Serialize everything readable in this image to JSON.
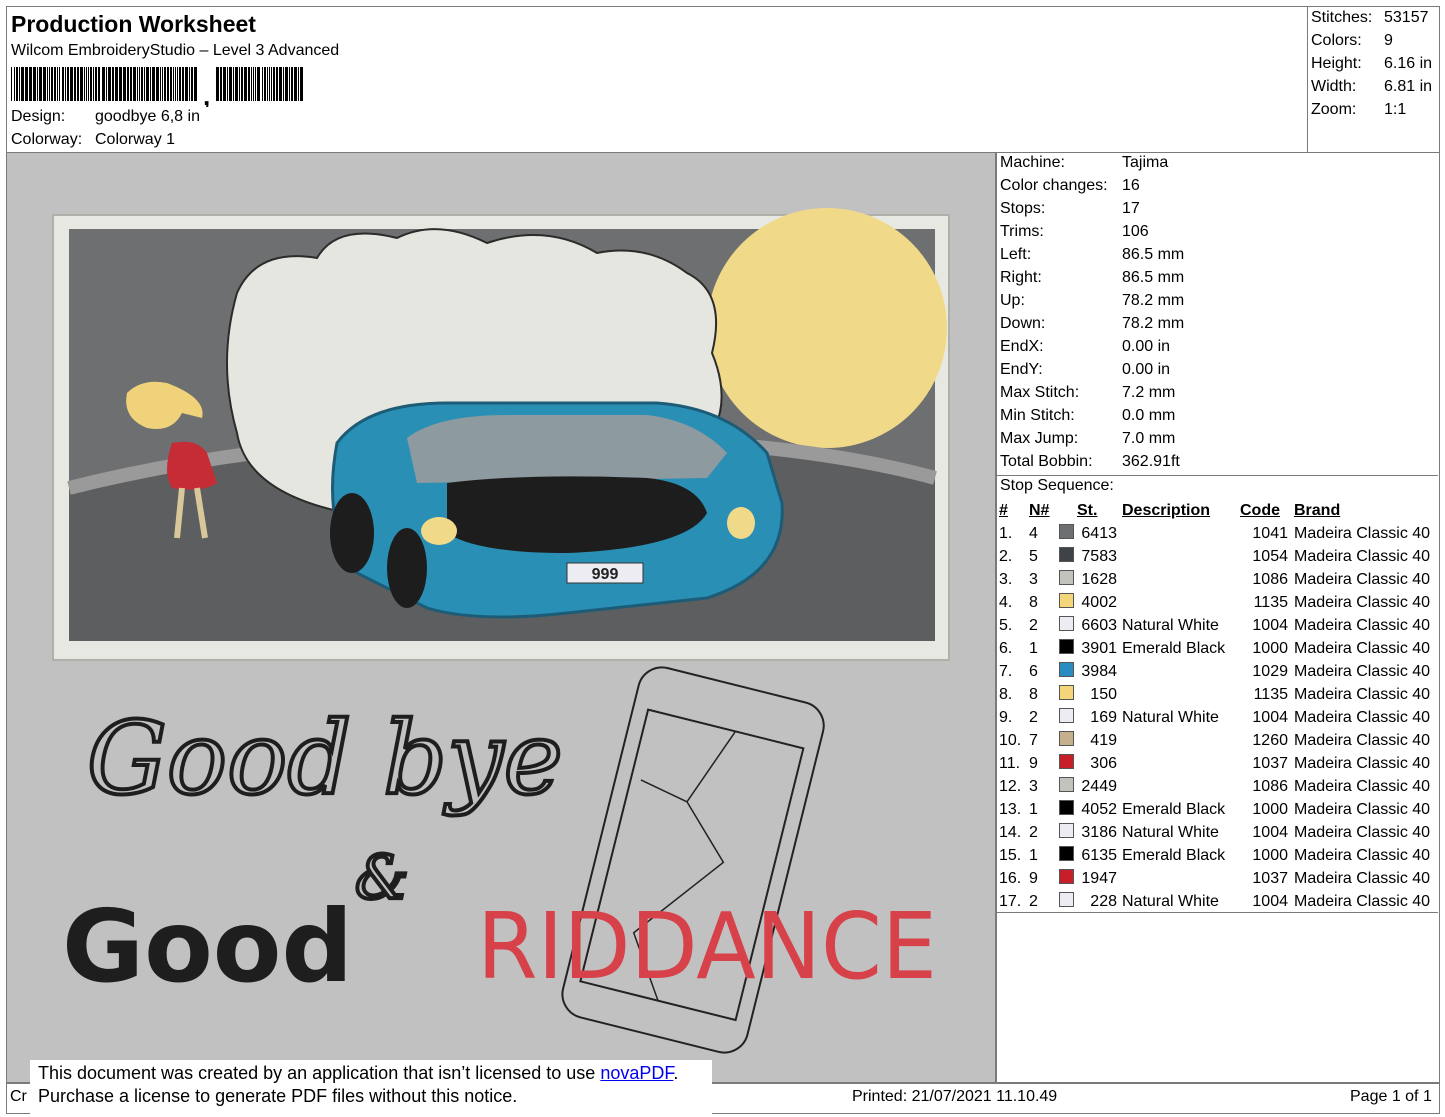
{
  "header": {
    "title": "Production Worksheet",
    "subtitle": "Wilcom EmbroideryStudio – Level 3 Advanced",
    "design_label": "Design:",
    "design_value": "goodbye 6,8 in",
    "colorway_label": "Colorway:",
    "colorway_value": "Colorway 1"
  },
  "stats": {
    "stitches_label": "Stitches:",
    "stitches": "53157",
    "colors_label": "Colors:",
    "colors": "9",
    "height_label": "Height:",
    "height": "6.16 in",
    "width_label": "Width:",
    "width": "6.81 in",
    "zoom_label": "Zoom:",
    "zoom": "1:1"
  },
  "preview": {
    "text_goodbye": "Good bye",
    "text_amp": "&",
    "text_good": "Good",
    "text_riddance": "RIDDANCE",
    "plate": "999",
    "colors": {
      "background": "#c1c1c1",
      "sky": "#6e6f70",
      "moon": "#f1d98a",
      "car": "#2a8fb5",
      "smoke": "#e6e6e0",
      "dress": "#c62c35",
      "hair": "#f0d27a",
      "riddance": "#d7424a",
      "goodbye": "#1e1e1e"
    }
  },
  "details": {
    "machine_label": "Machine:",
    "machine": "Tajima",
    "color_changes_label": "Color changes:",
    "color_changes": "16",
    "stops_label": "Stops:",
    "stops": "17",
    "trims_label": "Trims:",
    "trims": "106",
    "left_label": "Left:",
    "left": "86.5 mm",
    "right_label": "Right:",
    "right": "86.5 mm",
    "up_label": "Up:",
    "up": "78.2 mm",
    "down_label": "Down:",
    "down": "78.2 mm",
    "endx_label": "EndX:",
    "endx": "0.00 in",
    "endy_label": "EndY:",
    "endy": "0.00 in",
    "max_stitch_label": "Max Stitch:",
    "max_stitch": "7.2 mm",
    "min_stitch_label": "Min Stitch:",
    "min_stitch": "0.0 mm",
    "max_jump_label": "Max Jump:",
    "max_jump": "7.0 mm",
    "total_bobbin_label": "Total Bobbin:",
    "total_bobbin": "362.91ft",
    "stop_sequence_label": "Stop Sequence:"
  },
  "stop_table": {
    "headers": {
      "idx": "#",
      "n": "N#",
      "st": "St.",
      "desc": "Description",
      "code": "Code",
      "brand": "Brand"
    },
    "rows": [
      {
        "idx": "1.",
        "n": "4",
        "color": "#6d6f71",
        "st": "6413",
        "desc": "",
        "code": "1041",
        "brand": "Madeira Classic 40"
      },
      {
        "idx": "2.",
        "n": "5",
        "color": "#3f4247",
        "st": "7583",
        "desc": "",
        "code": "1054",
        "brand": "Madeira Classic 40"
      },
      {
        "idx": "3.",
        "n": "3",
        "color": "#c3c3bd",
        "st": "1628",
        "desc": "",
        "code": "1086",
        "brand": "Madeira Classic 40"
      },
      {
        "idx": "4.",
        "n": "8",
        "color": "#f5d57a",
        "st": "4002",
        "desc": "",
        "code": "1135",
        "brand": "Madeira Classic 40"
      },
      {
        "idx": "5.",
        "n": "2",
        "color": "#ececf2",
        "st": "6603",
        "desc": "Natural White",
        "code": "1004",
        "brand": "Madeira Classic 40"
      },
      {
        "idx": "6.",
        "n": "1",
        "color": "#000000",
        "st": "3901",
        "desc": "Emerald Black",
        "code": "1000",
        "brand": "Madeira Classic 40"
      },
      {
        "idx": "7.",
        "n": "6",
        "color": "#2a8cc0",
        "st": "3984",
        "desc": "",
        "code": "1029",
        "brand": "Madeira Classic 40"
      },
      {
        "idx": "8.",
        "n": "8",
        "color": "#f5d57a",
        "st": "150",
        "desc": "",
        "code": "1135",
        "brand": "Madeira Classic 40"
      },
      {
        "idx": "9.",
        "n": "2",
        "color": "#ececf2",
        "st": "169",
        "desc": "Natural White",
        "code": "1004",
        "brand": "Madeira Classic 40"
      },
      {
        "idx": "10.",
        "n": "7",
        "color": "#c4b08c",
        "st": "419",
        "desc": "",
        "code": "1260",
        "brand": "Madeira Classic 40"
      },
      {
        "idx": "11.",
        "n": "9",
        "color": "#c81e2a",
        "st": "306",
        "desc": "",
        "code": "1037",
        "brand": "Madeira Classic 40"
      },
      {
        "idx": "12.",
        "n": "3",
        "color": "#c3c3bd",
        "st": "2449",
        "desc": "",
        "code": "1086",
        "brand": "Madeira Classic 40"
      },
      {
        "idx": "13.",
        "n": "1",
        "color": "#000000",
        "st": "4052",
        "desc": "Emerald Black",
        "code": "1000",
        "brand": "Madeira Classic 40"
      },
      {
        "idx": "14.",
        "n": "2",
        "color": "#ececf2",
        "st": "3186",
        "desc": "Natural White",
        "code": "1004",
        "brand": "Madeira Classic 40"
      },
      {
        "idx": "15.",
        "n": "1",
        "color": "#000000",
        "st": "6135",
        "desc": "Emerald Black",
        "code": "1000",
        "brand": "Madeira Classic 40"
      },
      {
        "idx": "16.",
        "n": "9",
        "color": "#c81e2a",
        "st": "1947",
        "desc": "",
        "code": "1037",
        "brand": "Madeira Classic 40"
      },
      {
        "idx": "17.",
        "n": "2",
        "color": "#ececf2",
        "st": "228",
        "desc": "Natural White",
        "code": "1004",
        "brand": "Madeira Classic 40"
      }
    ]
  },
  "footer": {
    "cr": "Cr",
    "printed": "Printed: 21/07/2021 11.10.49",
    "page": "Page 1 of 1"
  },
  "notice": {
    "line1_prefix": "This document was created by an application that isn’t licensed to use ",
    "link": "novaPDF",
    "line1_suffix": ".",
    "line2": "Purchase a license to generate PDF files without this notice."
  }
}
